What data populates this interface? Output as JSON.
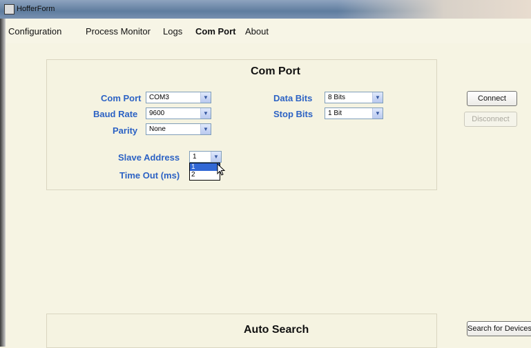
{
  "window": {
    "title": "HofferForm"
  },
  "menu": {
    "items": [
      "Configuration",
      "Process Monitor",
      "Logs",
      "Com Port",
      "About"
    ]
  },
  "com_panel": {
    "title": "Com Port",
    "fields": {
      "com_port": {
        "label": "Com Port",
        "value": "COM3"
      },
      "baud_rate": {
        "label": "Baud Rate",
        "value": "9600"
      },
      "parity": {
        "label": "Parity",
        "value": "None"
      },
      "data_bits": {
        "label": "Data Bits",
        "value": "8 Bits"
      },
      "stop_bits": {
        "label": "Stop Bits",
        "value": "1 Bit"
      },
      "slave_address": {
        "label": "Slave Address",
        "value": "1",
        "options": [
          "1",
          "2"
        ]
      },
      "timeout": {
        "label": "Time Out (ms)"
      }
    }
  },
  "buttons": {
    "connect": "Connect",
    "disconnect": "Disconnect",
    "search": "Search for Devices"
  },
  "auto_search_panel": {
    "title": "Auto Search"
  },
  "icons": {
    "combo_arrow": "chevron-down-icon",
    "cursor": "mouse-pointer-icon"
  }
}
